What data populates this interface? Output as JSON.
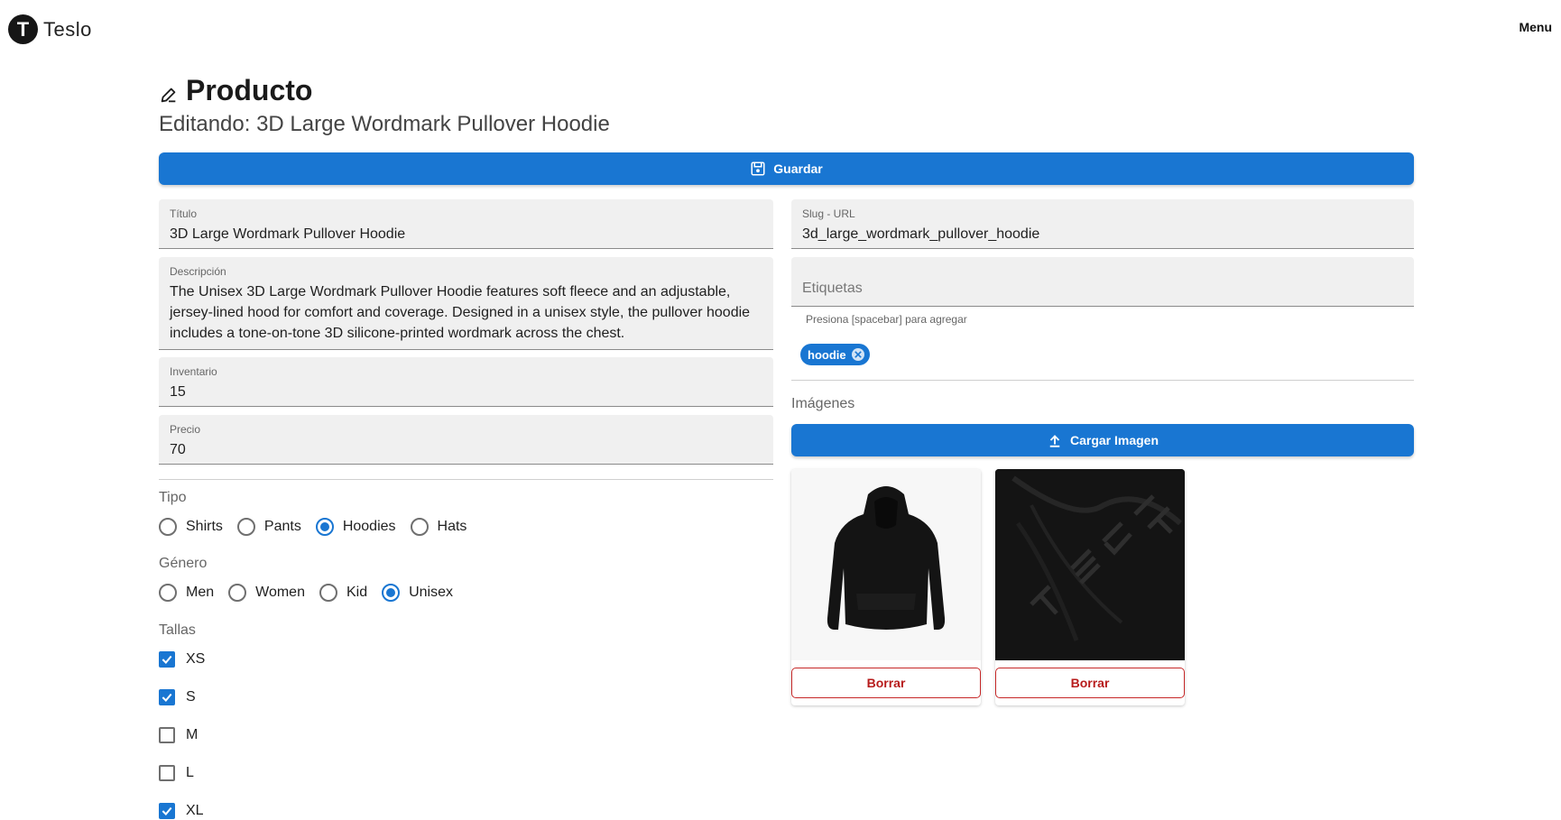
{
  "header": {
    "logo_letter": "T",
    "brand": "Teslo",
    "menu_label": "Menu"
  },
  "page": {
    "title": "Producto",
    "subtitle": "Editando: 3D Large Wordmark Pullover Hoodie"
  },
  "toolbar": {
    "save_label": "Guardar"
  },
  "form": {
    "title": {
      "label": "Título",
      "value": "3D Large Wordmark Pullover Hoodie"
    },
    "description": {
      "label": "Descripción",
      "value": "The Unisex 3D Large Wordmark Pullover Hoodie features soft fleece and an adjustable, jersey-lined hood for comfort and coverage. Designed in a unisex style, the pullover hoodie includes a tone-on-tone 3D silicone-printed wordmark across the chest."
    },
    "inventory": {
      "label": "Inventario",
      "value": "15"
    },
    "price": {
      "label": "Precio",
      "value": "70"
    },
    "slug": {
      "label": "Slug - URL",
      "value": "3d_large_wordmark_pullover_hoodie"
    },
    "tags": {
      "placeholder": "Etiquetas",
      "helper": "Presiona [spacebar] para agregar",
      "items": [
        "hoodie"
      ]
    },
    "type": {
      "label": "Tipo",
      "options": [
        "Shirts",
        "Pants",
        "Hoodies",
        "Hats"
      ],
      "selected": "Hoodies"
    },
    "gender": {
      "label": "Género",
      "options": [
        "Men",
        "Women",
        "Kid",
        "Unisex"
      ],
      "selected": "Unisex"
    },
    "sizes": {
      "label": "Tallas",
      "items": [
        {
          "label": "XS",
          "checked": true
        },
        {
          "label": "S",
          "checked": true
        },
        {
          "label": "M",
          "checked": false
        },
        {
          "label": "L",
          "checked": false
        },
        {
          "label": "XL",
          "checked": true
        }
      ]
    }
  },
  "images": {
    "label": "Imágenes",
    "upload_label": "Cargar Imagen",
    "delete_label": "Borrar",
    "items": [
      {
        "name": "hoodie-front-photo"
      },
      {
        "name": "hoodie-closeup-photo"
      }
    ]
  },
  "colors": {
    "primary": "#1976d2",
    "danger": "#c62828",
    "field_bg": "#f0f0f0"
  }
}
